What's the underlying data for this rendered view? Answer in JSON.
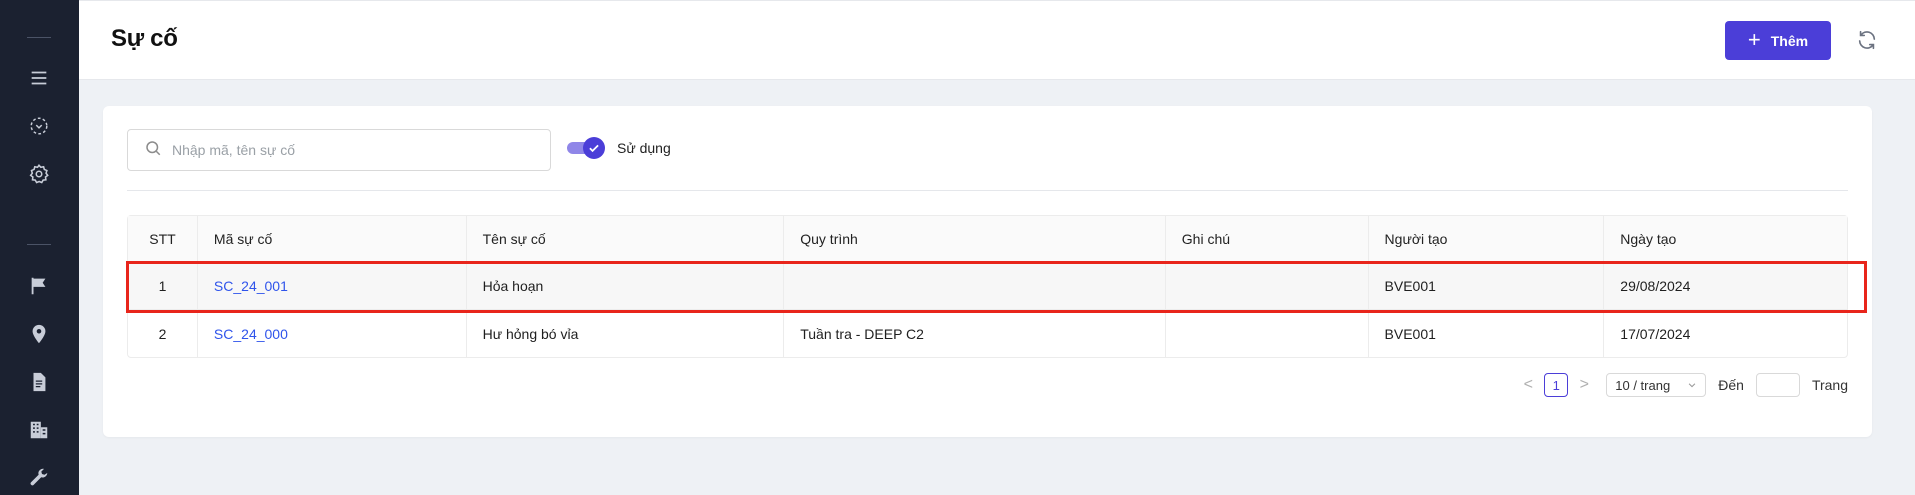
{
  "header": {
    "title": "Sự cố",
    "add_label": "Thêm"
  },
  "sidebar": {
    "icons": [
      "menu-icon",
      "scan-icon",
      "gear-icon",
      "flag-icon",
      "location-icon",
      "document-icon",
      "building-icon",
      "wrench-icon"
    ]
  },
  "filters": {
    "search_placeholder": "Nhập mã, tên sự cố",
    "toggle_label": "Sử dụng",
    "toggle_on": true
  },
  "table": {
    "headers": [
      "STT",
      "Mã sự cố",
      "Tên sự cố",
      "Quy trình",
      "Ghi chú",
      "Người tạo",
      "Ngày tạo"
    ],
    "rows": [
      {
        "stt": "1",
        "ma": "SC_24_001",
        "ten": "Hỏa hoạn",
        "quy_trinh": "",
        "ghi_chu": "",
        "nguoi_tao": "BVE001",
        "ngay_tao": "29/08/2024"
      },
      {
        "stt": "2",
        "ma": "SC_24_000",
        "ten": "Hư hỏng bó vỉa",
        "quy_trinh": "Tuần tra - DEEP C2",
        "ghi_chu": "",
        "nguoi_tao": "BVE001",
        "ngay_tao": "17/07/2024"
      }
    ]
  },
  "pagination": {
    "prev": "<",
    "current_page": "1",
    "next": ">",
    "page_size": "10 / trang",
    "goto_label": "Đến",
    "page_label": "Trang"
  },
  "colors": {
    "accent": "#4b3ed8",
    "sidebar": "#1b2130",
    "highlight": "#e8251b",
    "link": "#2f54eb"
  }
}
